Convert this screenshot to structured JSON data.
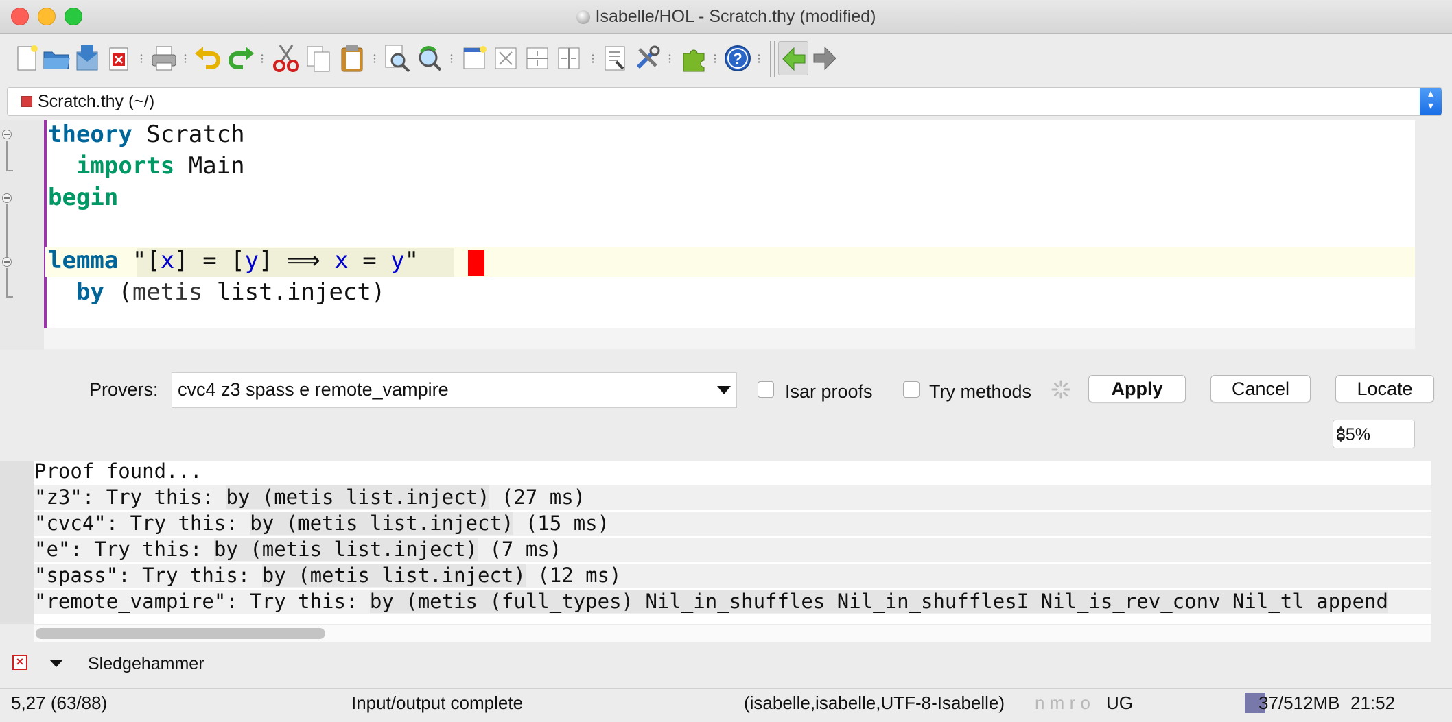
{
  "window": {
    "title": "Isabelle/HOL - Scratch.thy (modified)",
    "traffic_lights": {
      "close": "#fd5f57",
      "minimize": "#febc2e",
      "maximize": "#28c840"
    }
  },
  "toolbar": {
    "buttons": [
      "new-file-icon",
      "open-file-icon",
      "save-file-icon",
      "close-file-icon",
      "print-icon",
      "undo-icon",
      "redo-icon",
      "cut-icon",
      "copy-icon",
      "paste-icon",
      "find-icon",
      "find-replace-icon",
      "new-view-icon",
      "unsplit-icon",
      "split-horizontal-icon",
      "split-vertical-icon",
      "buffer-options-icon",
      "global-options-icon",
      "plugin-manager-icon",
      "help-icon",
      "back-icon",
      "forward-icon"
    ]
  },
  "file_selector": {
    "label": "Scratch.thy (~/)"
  },
  "editor": {
    "lines": [
      {
        "kw": "theory",
        "rest": " Scratch"
      },
      {
        "kw": "imports",
        "rest": " Main"
      },
      {
        "kw": "begin",
        "rest": ""
      },
      {
        "kw": "lemma",
        "q1": " \"[",
        "v1": "x",
        "q2": "] = [",
        "v2": "y",
        "q3": "] ⟹ ",
        "v3": "x",
        "q4": " = ",
        "v4": "y",
        "q5": "\""
      },
      {
        "kw": "by",
        "p1": " (",
        "meth": "metis",
        "rest": " list.inject)"
      }
    ]
  },
  "sledgehammer": {
    "provers_label": "Provers:",
    "provers_value": "cvc4 z3 spass e remote_vampire",
    "isar_proofs_label": "Isar proofs",
    "try_methods_label": "Try methods",
    "apply_label": "Apply",
    "cancel_label": "Cancel",
    "locate_label": "Locate",
    "zoom_value": "85%",
    "output": [
      {
        "pre": "Proof found...",
        "hl": "",
        "post": ""
      },
      {
        "pre": "\"z3\": Try this: ",
        "hl": "by (metis list.inject)",
        "post": " (27 ms)"
      },
      {
        "pre": "\"cvc4\": Try this: ",
        "hl": "by (metis list.inject)",
        "post": " (15 ms)"
      },
      {
        "pre": "\"e\": Try this: ",
        "hl": "by (metis list.inject)",
        "post": " (7 ms)"
      },
      {
        "pre": "\"spass\": Try this: ",
        "hl": "by (metis list.inject)",
        "post": " (12 ms)"
      },
      {
        "pre": "\"remote_vampire\": Try this: ",
        "hl": "by (metis (full_types) Nil_in_shuffles Nil_in_shufflesI Nil_is_rev_conv Nil_tl append",
        "post": ""
      }
    ],
    "tab_label": "Sledgehammer"
  },
  "status_bar": {
    "position": "5,27 (63/88)",
    "message": "Input/output complete",
    "mode": "(isabelle,isabelle,UTF-8-Isabelle)",
    "flags": "n m r o",
    "flags_active": "UG",
    "memory": "37/512MB",
    "memory_fraction": 0.07,
    "time": "21:52"
  }
}
